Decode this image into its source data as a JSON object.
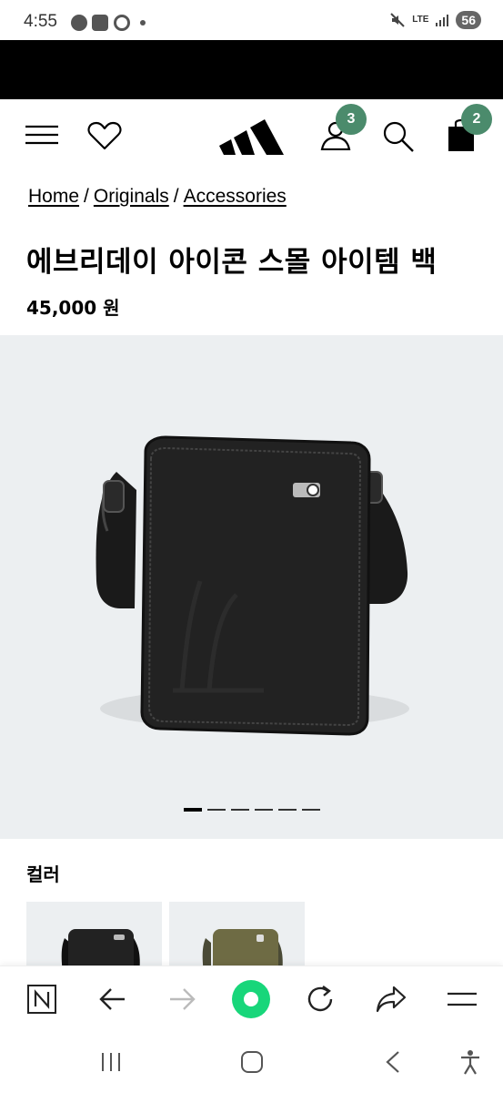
{
  "status_bar": {
    "time": "4:55",
    "network": "LTE",
    "battery": "56"
  },
  "header": {
    "account_badge": "3",
    "cart_badge": "2"
  },
  "breadcrumb": {
    "items": [
      "Home",
      "Originals",
      "Accessories"
    ],
    "separator": "/"
  },
  "product": {
    "title": "에브리데이 아이콘 스몰 아이템 백",
    "price": "45,000 원"
  },
  "carousel": {
    "total": 6,
    "active_index": 0
  },
  "color_section": {
    "heading": "컬러",
    "swatches": [
      "black",
      "olive"
    ]
  },
  "colors": {
    "badge": "#4b8b6c",
    "image_bg": "#eceff1",
    "browser_record": "#18d67a"
  },
  "icons": {
    "header": [
      "menu-icon",
      "heart-icon",
      "adidas-logo",
      "account-icon",
      "search-icon",
      "bag-icon"
    ],
    "toolbar": [
      "naver-n-icon",
      "back-arrow-icon",
      "forward-arrow-icon",
      "record-icon",
      "refresh-icon",
      "share-icon",
      "menu-lines-icon"
    ],
    "android_nav": [
      "recents-icon",
      "home-icon",
      "back-icon",
      "accessibility-icon"
    ]
  }
}
